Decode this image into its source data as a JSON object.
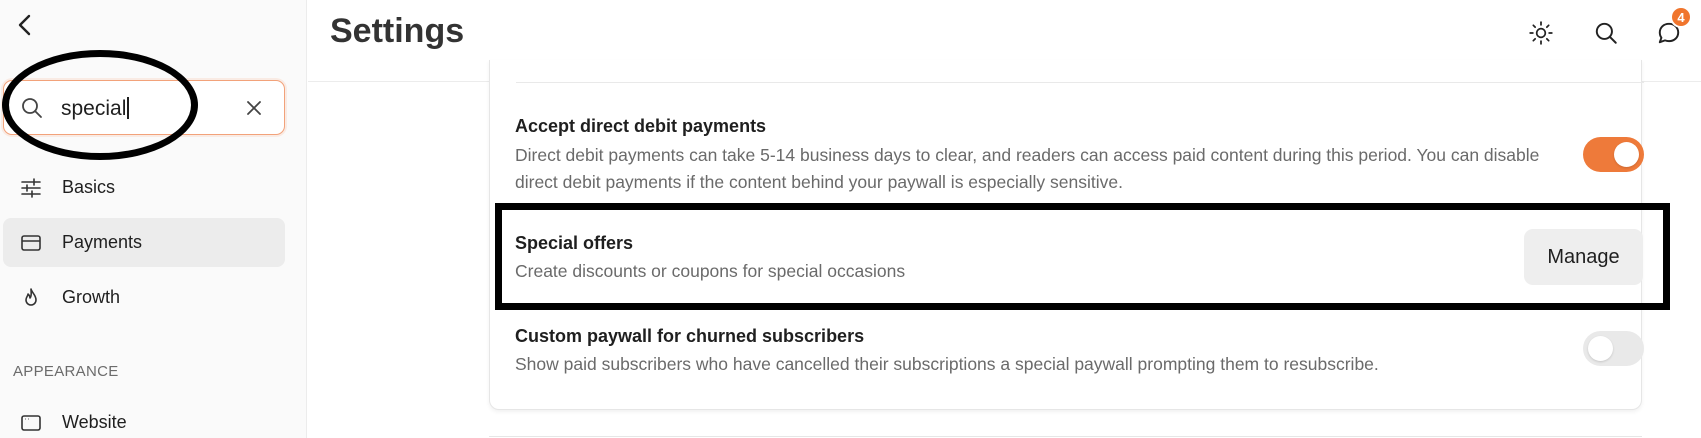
{
  "sidebar": {
    "search": {
      "value": "special"
    },
    "items": [
      {
        "label": "Basics",
        "icon": "sliders-icon",
        "active": false
      },
      {
        "label": "Payments",
        "icon": "credit-card-icon",
        "active": true
      },
      {
        "label": "Growth",
        "icon": "flame-icon",
        "active": false
      }
    ],
    "section_appearance": "APPEARANCE",
    "appearance_items": [
      {
        "label": "Website",
        "icon": "browser-window-icon"
      }
    ]
  },
  "header": {
    "title": "Settings",
    "notification_count": "4",
    "icons": [
      "sun-icon",
      "search-icon",
      "chat-bubble-icon"
    ]
  },
  "settings": {
    "direct_debit": {
      "title": "Accept direct debit payments",
      "description_line1": "Direct debit payments can take 5-14 business days to clear, and readers can access paid content during this period. You can disable",
      "description_line2": "direct debit payments if the content behind your paywall is especially sensitive.",
      "enabled": true
    },
    "special_offers": {
      "title": "Special offers",
      "description": "Create discounts or coupons for special occasions",
      "button_label": "Manage"
    },
    "custom_paywall": {
      "title": "Custom paywall for churned subscribers",
      "description": "Show paid subscribers who have cancelled their subscriptions a special paywall prompting them to resubscribe.",
      "enabled": false
    }
  },
  "colors": {
    "accent": "#ee7a3a",
    "badge": "#f0752d"
  }
}
